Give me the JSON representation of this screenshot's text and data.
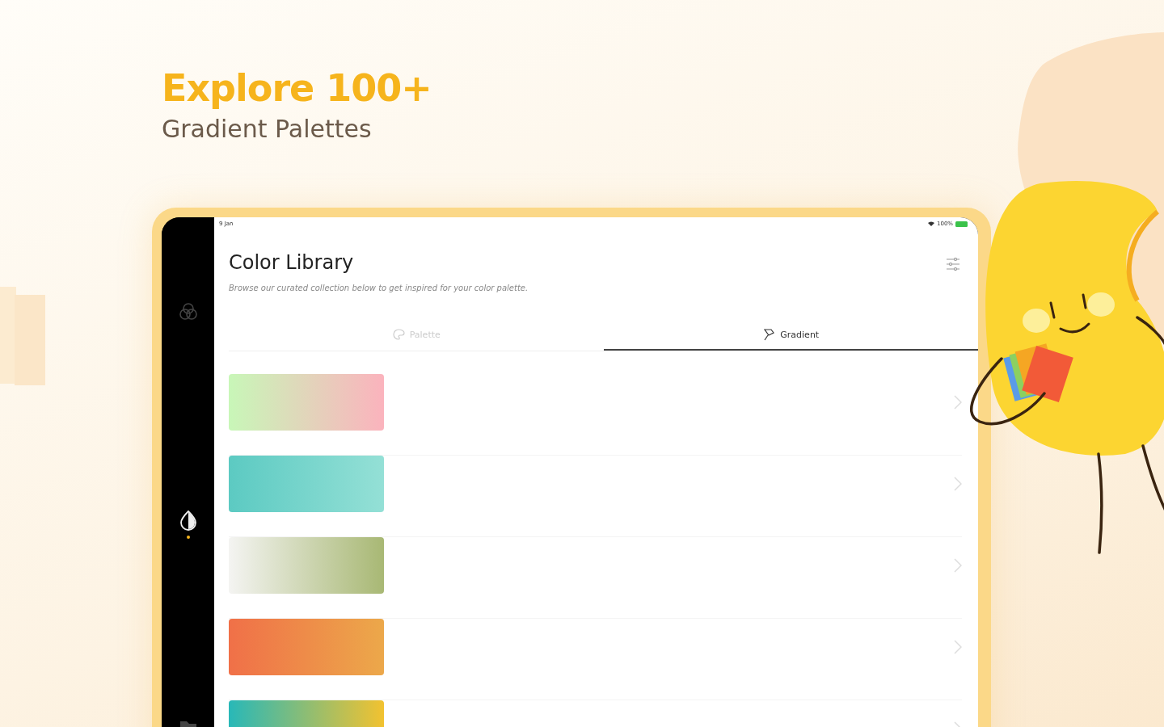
{
  "headline": {
    "title": "Explore 100+",
    "subtitle": "Gradient Palettes"
  },
  "status_bar": {
    "time": "9 Jan",
    "battery": "100%"
  },
  "sidebar": {
    "items": [
      {
        "selected": false
      },
      {
        "selected": true
      },
      {
        "selected": false
      }
    ]
  },
  "header": {
    "title": "Color Library",
    "description": "Browse our curated collection below to get inspired for your color palette."
  },
  "tabs": [
    {
      "label": "Palette",
      "selected": false
    },
    {
      "label": "Gradient",
      "selected": true
    }
  ],
  "gradients": [
    {
      "color": "#c8f7b8"
    },
    {
      "color": "#5ccac2"
    },
    {
      "color": "#f4f4f2"
    },
    {
      "color": "#f07048"
    },
    {
      "color": "#28b8b8"
    }
  ]
}
